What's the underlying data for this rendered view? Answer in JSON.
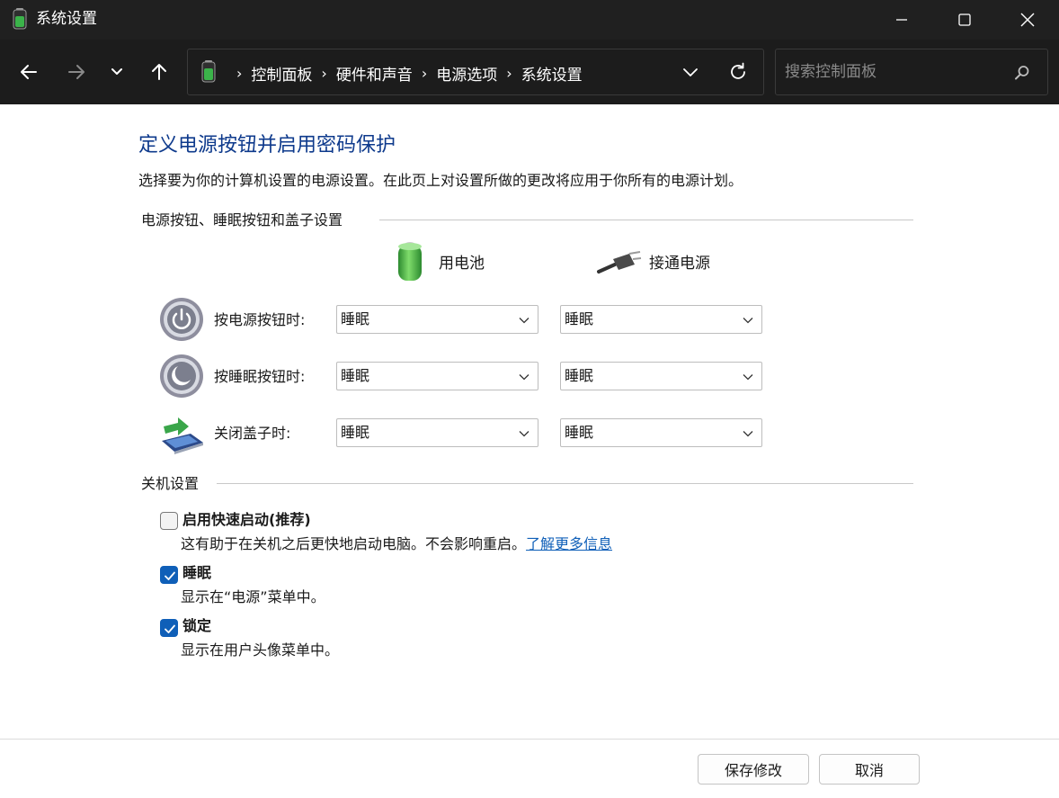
{
  "window": {
    "title": "系统设置"
  },
  "addressbar": {
    "crumbs": [
      "控制面板",
      "硬件和声音",
      "电源选项",
      "系统设置"
    ]
  },
  "search": {
    "placeholder": "搜索控制面板"
  },
  "main": {
    "title": "定义电源按钮并启用密码保护",
    "description": "选择要为你的计算机设置的电源设置。在此页上对设置所做的更改将应用于你所有的电源计划。",
    "buttons_section": {
      "heading": "电源按钮、睡眠按钮和盖子设置",
      "columns": [
        "用电池",
        "接通电源"
      ],
      "rows": [
        {
          "label": "按电源按钮时:",
          "battery": "睡眠",
          "plugged": "睡眠",
          "icon": "power-button-icon"
        },
        {
          "label": "按睡眠按钮时:",
          "battery": "睡眠",
          "plugged": "睡眠",
          "icon": "sleep-button-icon"
        },
        {
          "label": "关闭盖子时:",
          "battery": "睡眠",
          "plugged": "睡眠",
          "icon": "laptop-lid-icon"
        }
      ]
    },
    "shutdown_section": {
      "heading": "关机设置",
      "options": [
        {
          "title": "启用快速启动(推荐)",
          "desc": "这有助于在关机之后更快地启动电脑。不会影响重启。",
          "link": "了解更多信息",
          "checked": false
        },
        {
          "title": "睡眠",
          "desc": "显示在“电源”菜单中。",
          "checked": true
        },
        {
          "title": "锁定",
          "desc": "显示在用户头像菜单中。",
          "checked": true
        }
      ]
    }
  },
  "footer": {
    "save": "保存修改",
    "cancel": "取消"
  },
  "colors": {
    "titlebar": "#202020",
    "navbar": "#1c1c1c",
    "heading": "#0e3a8c",
    "accent": "#0f5fb8"
  }
}
